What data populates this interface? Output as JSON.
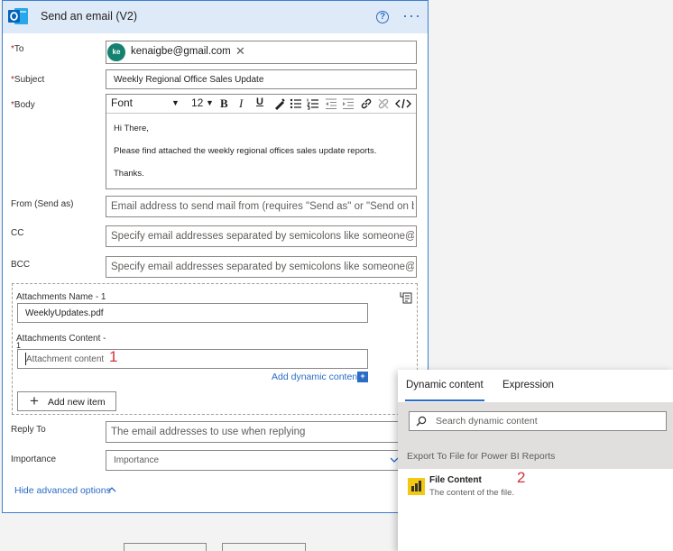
{
  "card": {
    "title": "Send an email (V2)",
    "help_glyph": "?",
    "more_glyph": "···"
  },
  "fields": {
    "to": {
      "label": "To",
      "required_mark": "*",
      "chip_initials": "ke",
      "chip_email": "kenaigbe@gmail.com"
    },
    "subject": {
      "label": "Subject",
      "required_mark": "*",
      "value": "Weekly Regional Office Sales Update"
    },
    "body": {
      "label": "Body",
      "required_mark": "*",
      "toolbar": {
        "font": "Font",
        "font_size": "12",
        "bold": "B",
        "italic": "I",
        "underline": "U"
      },
      "lines": [
        "Hi There,",
        "Please find attached the weekly regional offices sales update reports.",
        "Thanks."
      ]
    },
    "from": {
      "label": "From (Send as)",
      "placeholder": "Email address to send mail from (requires \"Send as\" or \"Send on beh"
    },
    "cc": {
      "label": "CC",
      "placeholder": "Specify email addresses separated by semicolons like someone@con"
    },
    "bcc": {
      "label": "BCC",
      "placeholder": "Specify email addresses separated by semicolons like someone@con"
    },
    "attachments": {
      "name_label": "Attachments Name - 1",
      "name_value": "WeeklyUpdates.pdf",
      "content_label": "Attachments Content -",
      "content_label_suffix": "1",
      "content_placeholder": "Attachment content",
      "add_dynamic": "Add dynamic content",
      "add_item": "Add new item"
    },
    "reply_to": {
      "label": "Reply To",
      "placeholder": "The email addresses to use when replying"
    },
    "importance": {
      "label": "Importance",
      "placeholder": "Importance"
    }
  },
  "hide_advanced": "Hide advanced options",
  "markers": {
    "one": "1",
    "two": "2"
  },
  "panel": {
    "tabs": [
      "Dynamic content",
      "Expression"
    ],
    "search_placeholder": "Search dynamic content",
    "section": "Export To File for Power BI Reports",
    "item_title": "File Content",
    "item_desc": "The content of the file."
  },
  "colors": {
    "accent": "#2b6cc4",
    "header_bg": "#dfeaf8",
    "marker_red": "#d13438",
    "powerbi_yellow": "#f2c811"
  }
}
